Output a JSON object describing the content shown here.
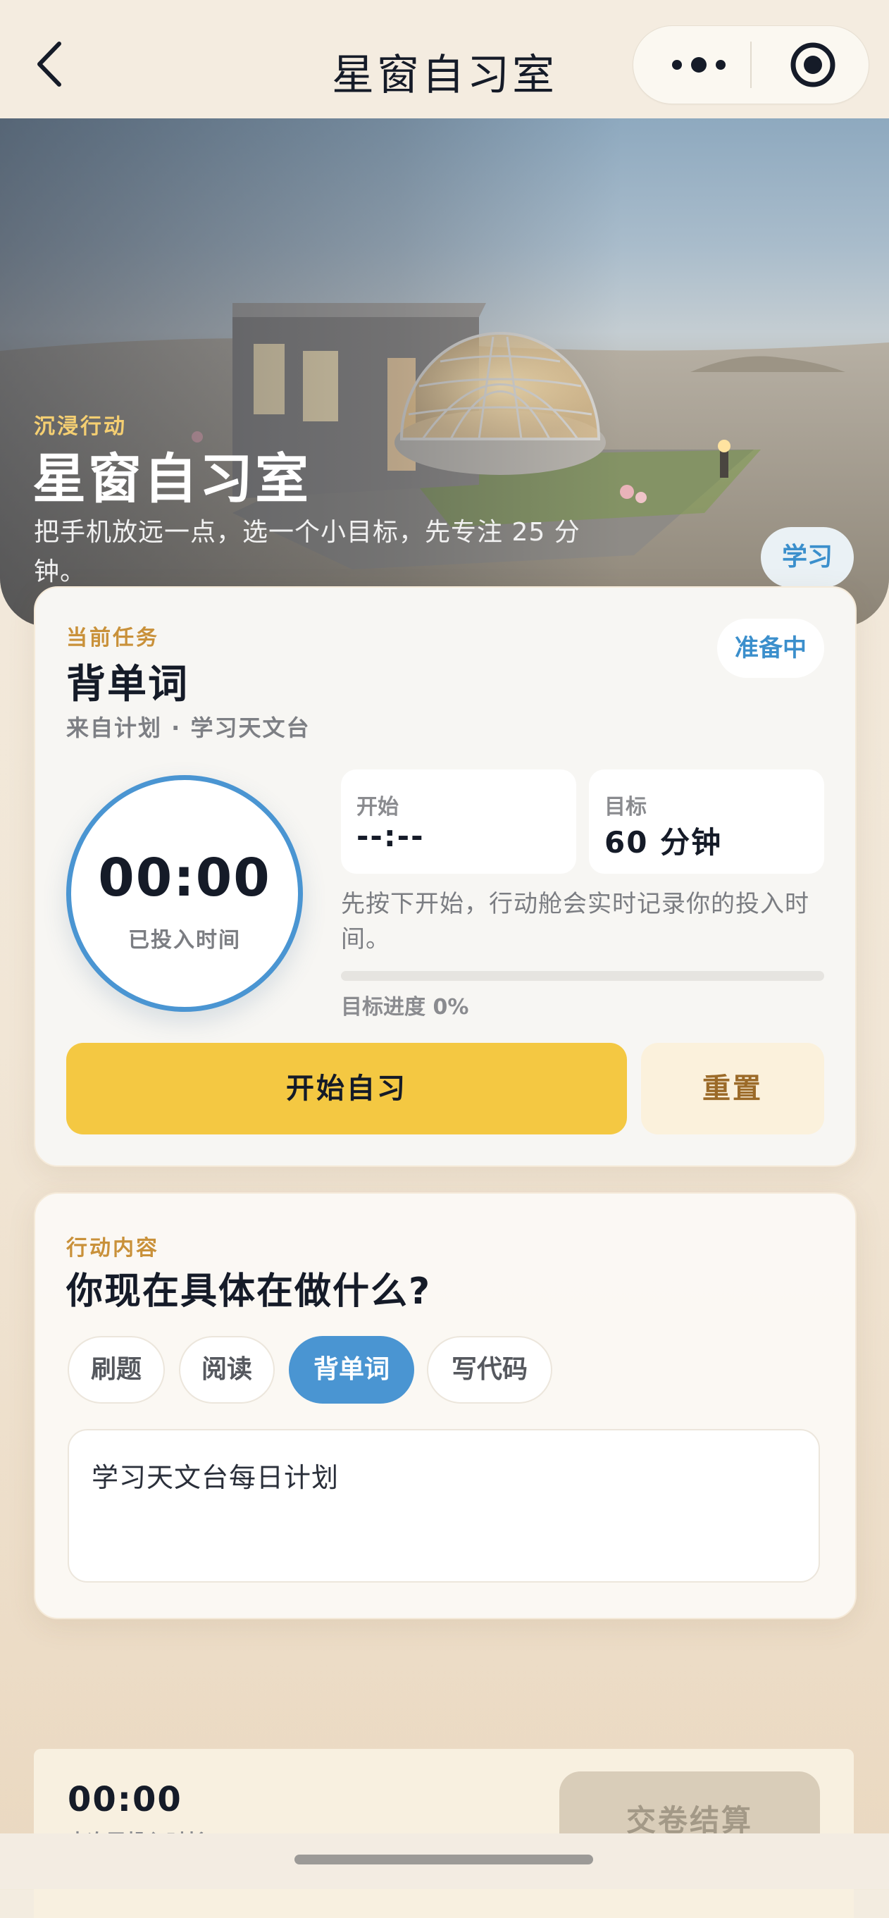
{
  "nav": {
    "title": "星窗自习室",
    "back_icon": "chevron-left-icon",
    "more_icon": "more-dots-icon",
    "close_icon": "target-circle-icon"
  },
  "hero": {
    "eyebrow": "沉浸行动",
    "title": "星窗自习室",
    "description": "把手机放远一点，选一个小目标，先专注 25 分钟。",
    "tag": "学习"
  },
  "task_card": {
    "eyebrow": "当前任务",
    "status": "准备中",
    "title": "背单词",
    "source": "来自计划 · 学习天文台",
    "timer": {
      "value": "00:00",
      "label": "已投入时间"
    },
    "start": {
      "label": "开始",
      "value": "--:--"
    },
    "goal": {
      "label": "目标",
      "value": "60 分钟"
    },
    "hint": "先按下开始，行动舱会实时记录你的投入时间。",
    "progress": {
      "fraction": 0,
      "label": "目标进度 0%"
    },
    "start_button": "开始自习",
    "reset_button": "重置"
  },
  "activity_card": {
    "eyebrow": "行动内容",
    "title": "你现在具体在做什么?",
    "chips": [
      {
        "label": "刷题",
        "active": false
      },
      {
        "label": "阅读",
        "active": false
      },
      {
        "label": "背单词",
        "active": true
      },
      {
        "label": "写代码",
        "active": false
      }
    ],
    "note": "学习天文台每日计划"
  },
  "bottom_bar": {
    "timer": "00:00",
    "subtext": "本次已投入时长",
    "submit_button": "交卷结算"
  },
  "colors": {
    "accent_blue": "#4a95d2",
    "primary_yellow": "#f4c842",
    "eyebrow_gold": "#c9913a"
  }
}
